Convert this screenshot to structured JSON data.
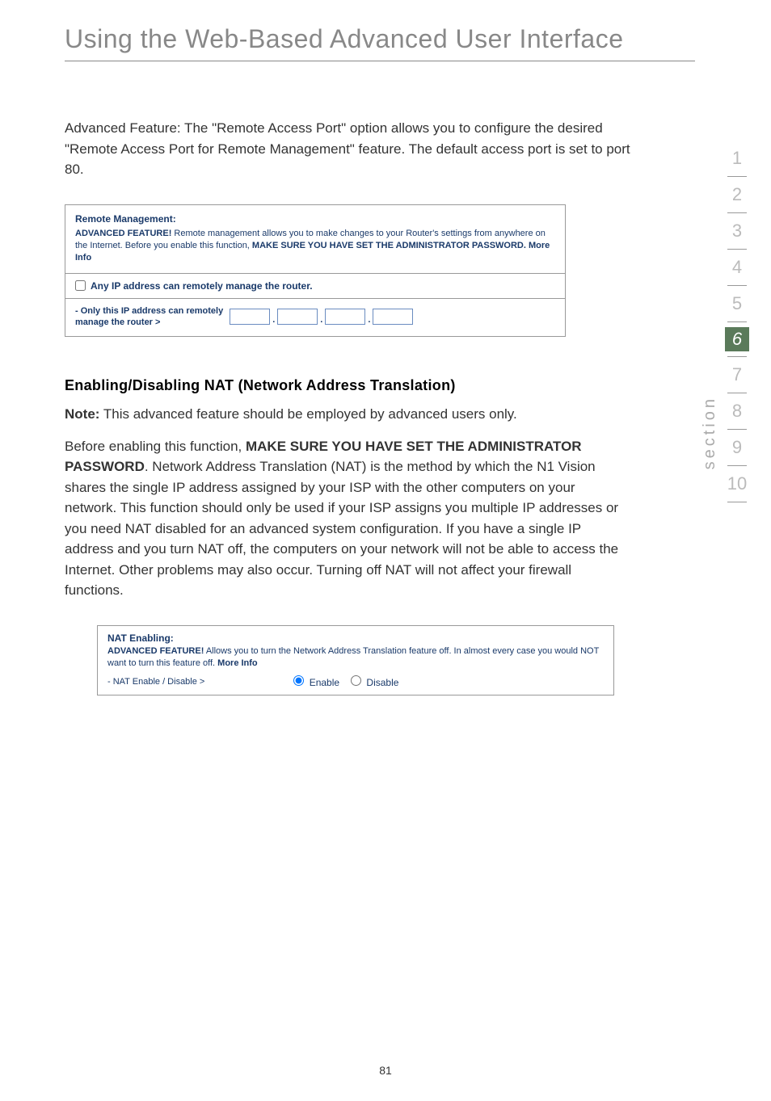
{
  "page": {
    "title": "Using the Web-Based Advanced User Interface",
    "intro": "Advanced Feature: The \"Remote Access Port\" option allows you to configure the desired \"Remote Access Port for Remote Management\" feature. The default access port is set to port 80.",
    "page_number": "81"
  },
  "remote_panel": {
    "title": "Remote Management:",
    "lead": "ADVANCED FEATURE!",
    "text": " Remote management allows you to make changes to your Router's settings from anywhere on the Internet. Before you enable this function, ",
    "bold_text": "MAKE SURE YOU HAVE SET THE ADMINISTRATOR PASSWORD.",
    "more_info": " More Info",
    "checkbox_label": "Any IP address can remotely manage the router.",
    "ip_label": "- Only this IP address can remotely manage the router >"
  },
  "nat_section": {
    "heading": "Enabling/Disabling NAT (Network Address Translation)",
    "note_bold": "Note:",
    "note_text": " This advanced feature should be employed by advanced users only.",
    "body_pre": "Before enabling this function, ",
    "body_bold": "MAKE SURE YOU HAVE SET THE ADMINISTRATOR PASSWORD",
    "body_post": ". Network Address Translation (NAT) is the method by which the N1 Vision shares the single IP address assigned by your ISP with the other computers on your network. This function should only be used if your ISP assigns you multiple IP addresses or you need NAT disabled for an advanced system configuration. If you have a single IP address and you turn NAT off, the computers on your network will not be able to access the Internet. Other problems may also occur. Turning off NAT will not affect your firewall functions."
  },
  "nat_panel": {
    "title": "NAT Enabling:",
    "lead": "ADVANCED FEATURE!",
    "text": " Allows you to turn the Network Address Translation feature off. In almost every case you would NOT want to turn this feature off. ",
    "more_info": "More Info",
    "row_label": "- NAT Enable / Disable >",
    "enable": "Enable",
    "disable": "Disable"
  },
  "nav": {
    "items": [
      "1",
      "2",
      "3",
      "4",
      "5",
      "6",
      "7",
      "8",
      "9",
      "10"
    ],
    "active_index": 5,
    "section_label": "section"
  }
}
